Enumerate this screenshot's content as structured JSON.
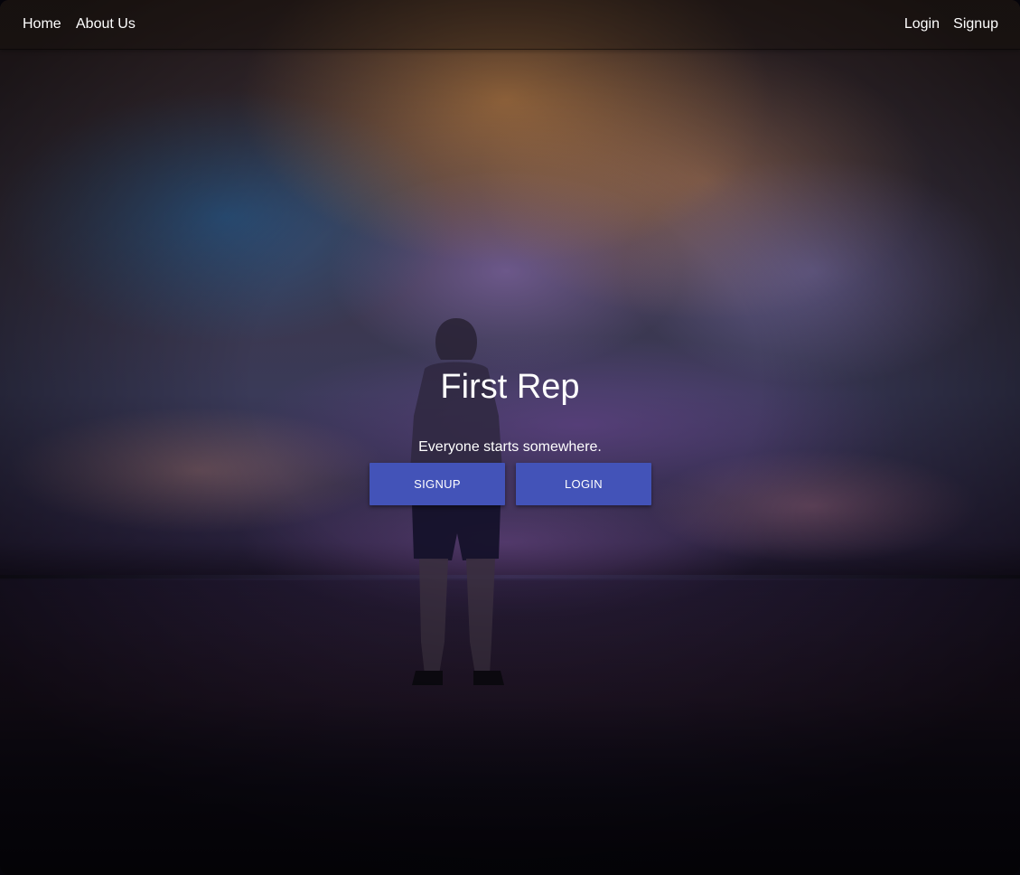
{
  "nav": {
    "left": [
      {
        "label": "Home"
      },
      {
        "label": "About Us"
      }
    ],
    "right": [
      {
        "label": "Login"
      },
      {
        "label": "Signup"
      }
    ]
  },
  "hero": {
    "title": "First Rep",
    "subtitle": "Everyone starts somewhere.",
    "buttons": {
      "signup_label": "SIGNUP",
      "login_label": "LOGIN"
    },
    "button_color": "#4353b8",
    "background_image": "hooded-person-standing-on-beach-at-sunset"
  }
}
